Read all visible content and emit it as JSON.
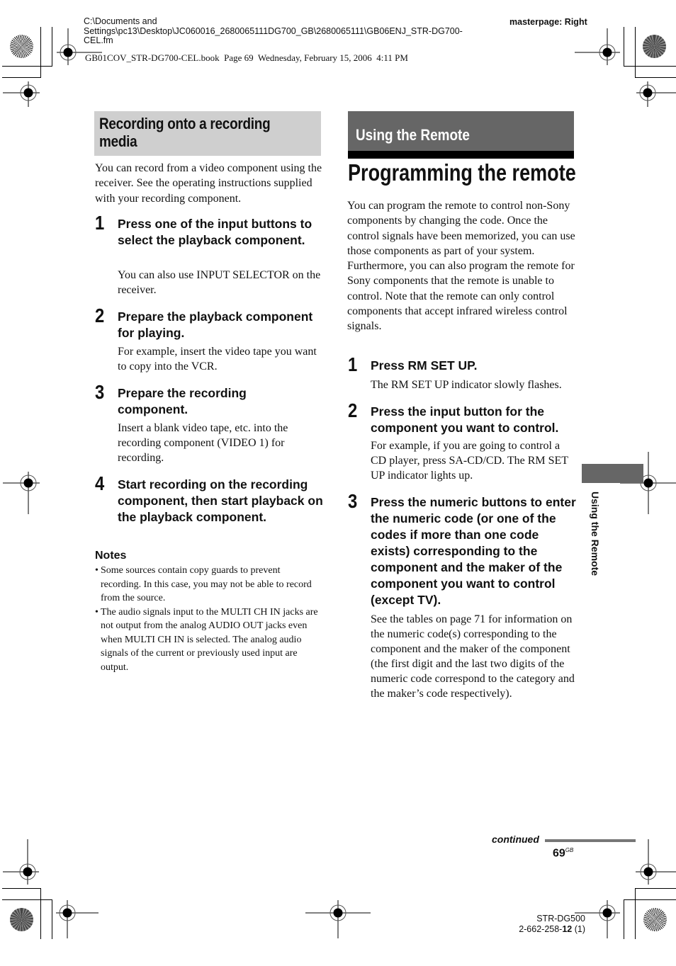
{
  "header": {
    "path_lines": [
      "C:\\Documents and",
      "Settings\\pc13\\Desktop\\JC060016_2680065111DG700_GB\\2680065111\\GB06ENJ_STR-DG700-",
      "CEL.fm"
    ],
    "book_line": "GB01COV_STR-DG700-CEL.book  Page 69  Wednesday, February 15, 2006  4:11 PM",
    "masterpage": "masterpage: Right"
  },
  "left": {
    "section_heading": [
      "Recording onto a recording",
      "media"
    ],
    "intro": "You can record from a video component using the receiver. See the operating instructions supplied with your recording component.",
    "steps": [
      {
        "num": "1",
        "title": "Press one of the input buttons to select the playback component.",
        "desc": "You can also use INPUT SELECTOR on the receiver."
      },
      {
        "num": "2",
        "title": "Prepare the playback component for playing.",
        "desc": "For example, insert the video tape you want to copy into the VCR."
      },
      {
        "num": "3",
        "title": "Prepare the recording component.",
        "desc": "Insert a blank video tape, etc. into the recording component (VIDEO 1) for recording."
      },
      {
        "num": "4",
        "title": "Start recording on the recording component, then start playback on the playback component.",
        "desc": ""
      }
    ],
    "notes_title": "Notes",
    "notes": [
      "Some sources contain copy guards to prevent recording. In this case, you may not be able to record from the source.",
      "The audio signals input to the MULTI CH IN jacks are not output from the analog AUDIO OUT jacks even when MULTI CH IN is selected. The analog audio signals of the current or previously used input are output."
    ]
  },
  "right": {
    "section_heading": "Using the Remote",
    "page_title": "Programming the remote",
    "intro_1": "You can program the remote to control non-Sony components by changing the code. Once the control signals have been memorized, you can use those components as part of your system.",
    "intro_2": "Furthermore, you can also program the remote for Sony components that the remote is unable to control. Note that the remote can only control components that accept infrared wireless control signals.",
    "steps": [
      {
        "num": "1",
        "title": "Press RM SET UP.",
        "desc": "The RM SET UP indicator slowly flashes."
      },
      {
        "num": "2",
        "title": "Press the input button for the component you want to control.",
        "desc": "For example, if you are going to control a CD player, press SA-CD/CD. The RM SET UP indicator lights up."
      },
      {
        "num": "3",
        "title": "Press the numeric buttons to enter the numeric code (or one of the codes if more than one code exists) corresponding to the component and the maker of the component you want to control (except TV).",
        "desc": "See the tables on page 71 for information on the numeric code(s) corresponding to the component and the maker of the component (the first digit and the last two digits of the numeric code correspond to the category and the maker’s code respectively)."
      }
    ]
  },
  "side_tab": {
    "label": "Using the Remote"
  },
  "footer": {
    "continued": "continued",
    "page_number": "69",
    "page_suffix": "GB",
    "model": "STR-DG500",
    "code_prefix": "2-662-258-",
    "code_bold": "12",
    "code_suffix": " (1)"
  }
}
